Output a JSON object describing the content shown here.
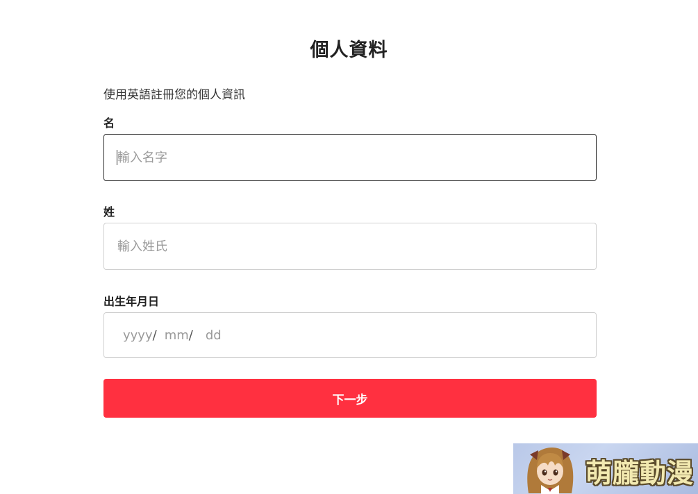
{
  "header": {
    "title": "個人資料",
    "subtitle": "使用英語註冊您的個人資訊"
  },
  "form": {
    "first_name": {
      "label": "名",
      "placeholder": "輸入名字",
      "value": ""
    },
    "last_name": {
      "label": "姓",
      "placeholder": "輸入姓氏",
      "value": ""
    },
    "birthday": {
      "label": "出生年月日",
      "year_placeholder": "yyyy",
      "month_placeholder": "mm",
      "day_placeholder": "dd",
      "separator": "/"
    },
    "next_label": "下一步"
  },
  "colors": {
    "accent": "#ff3040",
    "focused_border": "#2a2a2a",
    "border": "#cfcfcf"
  },
  "watermark": {
    "text": "萌朧動漫"
  }
}
